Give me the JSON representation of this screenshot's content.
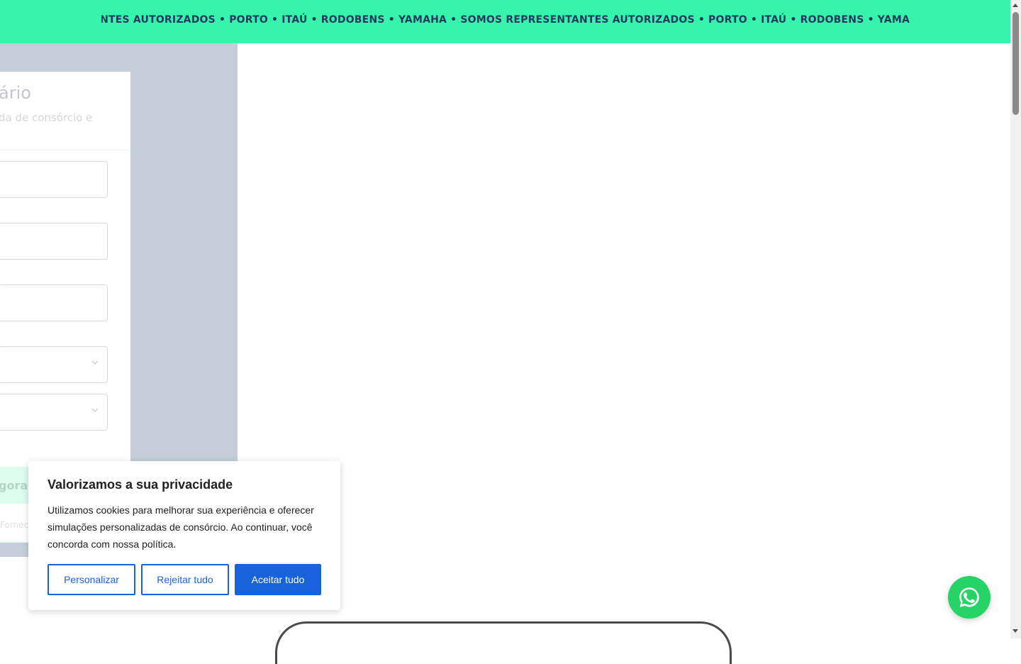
{
  "banner": {
    "marquee_text": "SOMOS REPRESENTANTES AUTORIZADOS • PORTO • ITAÚ • RODOBENS • YAMAHA • SOMOS REPRESENTANTES AUTORIZADOS • PORTO • ITAÚ • RODOBENS • YAMA",
    "background_color": "#36f4ac",
    "text_color": "#1e3a5f"
  },
  "form": {
    "title_fragment": "ário",
    "subtitle_fragment": "da de consórcio e",
    "submit_fragment": "gora",
    "footnote_fragment": "Fornec"
  },
  "cookie_consent": {
    "title": "Valorizamos a sua privacidade",
    "body": "Utilizamos cookies para melhorar sua experiência e oferecer simulações personalizadas de consórcio. Ao continuar, você concorda com nossa política.",
    "customize_label": "Personalizar",
    "reject_label": "Rejeitar tudo",
    "accept_label": "Aceitar tudo",
    "accent_color": "#1863dc"
  },
  "icons": {
    "whatsapp": "whatsapp-icon",
    "select_chevron": "chevron-down-icon",
    "whatsapp_color": "#25d366"
  }
}
